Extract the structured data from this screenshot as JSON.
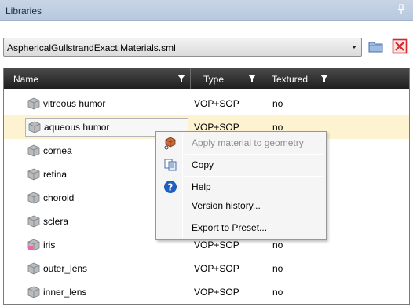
{
  "panel": {
    "title": "Libraries"
  },
  "library_selector": {
    "value": "AsphericalGullstrandExact.Materials.sml"
  },
  "table": {
    "columns": [
      "Name",
      "Type",
      "Textured"
    ],
    "rows": [
      {
        "name": "vitreous humor",
        "type": "VOP+SOP",
        "textured": "no"
      },
      {
        "name": "aqueous humor",
        "type": "VOP+SOP",
        "textured": "no"
      },
      {
        "name": "cornea",
        "type": "",
        "textured": ""
      },
      {
        "name": "retina",
        "type": "",
        "textured": ""
      },
      {
        "name": "choroid",
        "type": "",
        "textured": ""
      },
      {
        "name": "sclera",
        "type": "",
        "textured": ""
      },
      {
        "name": "iris",
        "type": "VOP+SOP",
        "textured": "no"
      },
      {
        "name": "outer_lens",
        "type": "VOP+SOP",
        "textured": "no"
      },
      {
        "name": "inner_lens",
        "type": "VOP+SOP",
        "textured": "no"
      }
    ]
  },
  "context_menu": {
    "items": [
      {
        "label": "Apply material to geometry",
        "enabled": false,
        "icon": "apply-material-icon"
      },
      {
        "label": "Copy",
        "enabled": true,
        "icon": "copy-icon"
      },
      {
        "label": "Help",
        "enabled": true,
        "icon": "help-icon"
      },
      {
        "label": "Version history...",
        "enabled": true,
        "icon": ""
      },
      {
        "label": "Export to Preset...",
        "enabled": true,
        "icon": ""
      }
    ]
  },
  "colors": {
    "header_bg": "#c8d5e6",
    "table_header_bg": "#2b2b2b",
    "selected_row_bg": "#fdf3d0",
    "delete_red": "#d8262b",
    "folder_blue": "#6b8fc6",
    "help_blue": "#1f5fbf"
  }
}
